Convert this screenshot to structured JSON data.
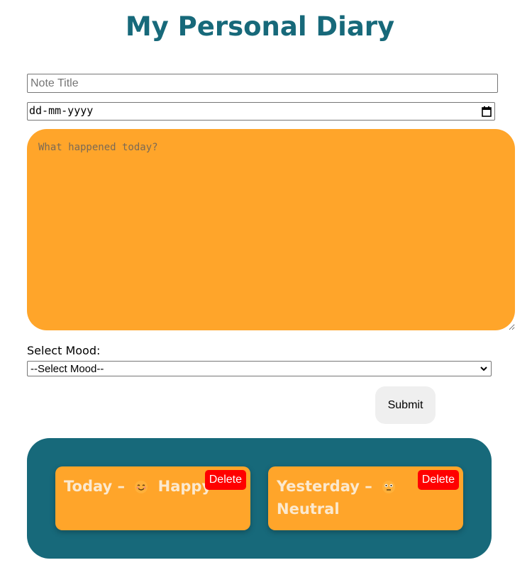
{
  "header": {
    "title": "My Personal Diary"
  },
  "form": {
    "title_placeholder": "Note Title",
    "date_placeholder": "dd-mm-yyyy",
    "entry_placeholder": "What happened today?",
    "mood_label": "Select Mood:",
    "mood_selected": "--Select Mood--",
    "submit_label": "Submit"
  },
  "notes": [
    {
      "title": "Today",
      "separator": "–",
      "mood": "Happy",
      "mood_icon": "smiling-face-icon",
      "delete_label": "Delete"
    },
    {
      "title": "Yesterday",
      "separator": "–",
      "mood": "Neutral",
      "mood_icon": "neutral-face-icon",
      "delete_label": "Delete"
    }
  ],
  "colors": {
    "accent": "#17697a",
    "card": "#ffa52a",
    "delete": "#ff0000",
    "submit_bg": "#efefef"
  }
}
